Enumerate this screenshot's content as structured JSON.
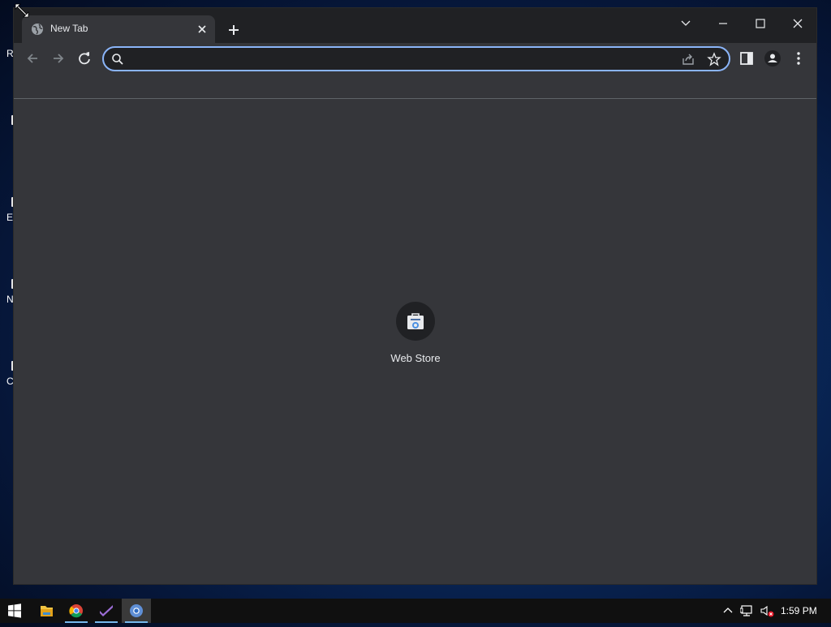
{
  "desktop": {
    "icons": [
      {
        "label": "R"
      },
      {
        "label": ""
      },
      {
        "label": "E"
      },
      {
        "label": "N"
      },
      {
        "label": "C"
      }
    ]
  },
  "browser": {
    "tab": {
      "title": "New Tab",
      "icon": "globe-icon"
    },
    "omnibox": {
      "value": "",
      "placeholder": ""
    },
    "shortcuts": [
      {
        "label": "Web Store",
        "icon": "web-store-icon"
      }
    ]
  },
  "taskbar": {
    "clock": "1:59 PM",
    "apps": [
      "file-explorer-icon",
      "chrome-icon",
      "visual-studio-icon",
      "chromium-icon"
    ]
  },
  "colors": {
    "accent": "#8ab4f8",
    "frame": "#202124",
    "surface": "#35363a",
    "text": "#e8eaed"
  }
}
